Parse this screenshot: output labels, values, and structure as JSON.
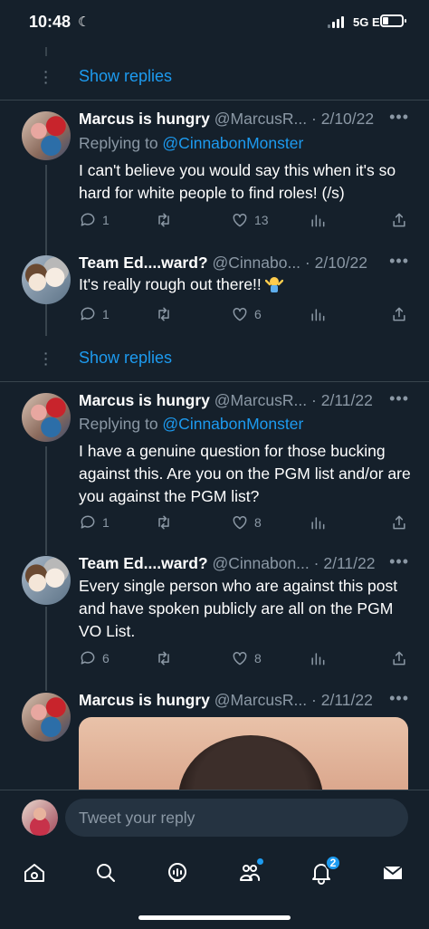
{
  "status_bar": {
    "time": "10:48",
    "network": "5G E",
    "battery_fraction": 0.3
  },
  "show_replies_label": "Show replies",
  "tweets": [
    {
      "name": "Marcus is hungry",
      "handle": "@MarcusR...",
      "date": "2/10/22",
      "replying_to_prefix": "Replying to ",
      "replying_to": "@CinnabonMonster",
      "text": "I can't believe you would say this when it's so hard for white people to find roles! (/s)",
      "replies": "1",
      "retweets": "",
      "likes": "13",
      "avatar_icon": "marcus-avatar"
    },
    {
      "name": "Team Ed....ward?",
      "handle": "@Cinnabo...",
      "date": "2/10/22",
      "text": "It's really rough out there!!",
      "emoji_icon": "person-shrugging-emoji",
      "replies": "1",
      "retweets": "",
      "likes": "6",
      "avatar_icon": "team-edward-avatar"
    },
    {
      "name": "Marcus is hungry",
      "handle": "@MarcusR...",
      "date": "2/11/22",
      "replying_to_prefix": "Replying to ",
      "replying_to": "@CinnabonMonster",
      "text": "I have a genuine question for those bucking against this. Are you on the PGM list and/or are you against the PGM list?",
      "replies": "1",
      "retweets": "",
      "likes": "8",
      "avatar_icon": "marcus-avatar"
    },
    {
      "name": "Team Ed....ward?",
      "handle": "@Cinnabon...",
      "date": "2/11/22",
      "text": "Every single person who are against this post and have spoken publicly are all on the PGM VO List.",
      "replies": "6",
      "retweets": "",
      "likes": "8",
      "avatar_icon": "team-edward-avatar"
    },
    {
      "name": "Marcus is hungry",
      "handle": "@MarcusR...",
      "date": "2/11/22",
      "media_icon": "photo-thumbnail",
      "avatar_icon": "marcus-avatar"
    }
  ],
  "separator": " · ",
  "composer": {
    "placeholder": "Tweet your reply"
  },
  "tabbar": {
    "items": [
      "home-icon",
      "search-icon",
      "spaces-icon",
      "communities-icon",
      "notifications-icon",
      "messages-icon"
    ],
    "notifications_badge": "2"
  },
  "colors": {
    "background": "#15202b",
    "accent": "#1d9bf0",
    "muted": "#8b98a5",
    "divider": "#38444d"
  }
}
